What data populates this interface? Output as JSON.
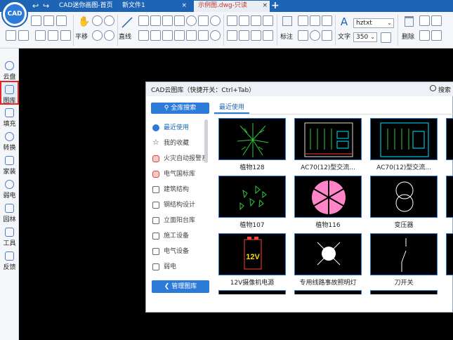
{
  "titlebar": {
    "tabs": [
      {
        "label": "CAD迷你画图-首页",
        "active": false
      },
      {
        "label": "新文件1",
        "active": false
      },
      {
        "label": "示例图.dwg-只读",
        "active": true
      }
    ],
    "tab_close": "×",
    "new_tab": "+",
    "logo_text": "CAD"
  },
  "toolbar": {
    "pan_label": "平移",
    "line_label": "直线",
    "annotate_label": "标注",
    "text_label": "文字",
    "delete_label": "删除",
    "font_value": "hztxt",
    "size_value": "350"
  },
  "sidebar": {
    "items": [
      {
        "label": "云盘",
        "active": false
      },
      {
        "label": "图库",
        "active": true
      },
      {
        "label": "填充",
        "active": false
      },
      {
        "label": "转换",
        "active": false
      },
      {
        "label": "家装",
        "active": false
      },
      {
        "label": "弱电",
        "active": false
      },
      {
        "label": "园林",
        "active": false
      },
      {
        "label": "工具",
        "active": false
      },
      {
        "label": "反馈",
        "active": false
      }
    ]
  },
  "dialog": {
    "title": "CAD云图库（快捷开关：Ctrl+Tab）",
    "search_label": "搜索",
    "all_search_button": "全库搜索",
    "recent_tab": "最近使用",
    "manage_button": "管理图库",
    "categories": [
      {
        "label": "最近使用",
        "icon": "clock-icon",
        "active": true
      },
      {
        "label": "我的收藏",
        "icon": "star-icon"
      },
      {
        "label": "火灾自动报警系",
        "icon": "shield-icon",
        "red": true
      },
      {
        "label": "电气国标库",
        "icon": "shield-icon",
        "red": true
      },
      {
        "label": "建筑结构",
        "icon": "image-icon"
      },
      {
        "label": "钢结构设计",
        "icon": "image-icon"
      },
      {
        "label": "立面阳台库",
        "icon": "image-icon"
      },
      {
        "label": "施工设备",
        "icon": "image-icon"
      },
      {
        "label": "电气设备",
        "icon": "image-icon"
      },
      {
        "label": "弱电",
        "icon": "image-icon"
      }
    ],
    "thumb_badge": "12V",
    "items": [
      {
        "label": "植物128"
      },
      {
        "label": "AC70(12)型交流..."
      },
      {
        "label": "AC70(12)型交流..."
      },
      {
        "label": "植物107"
      },
      {
        "label": "植物116"
      },
      {
        "label": "变压器"
      },
      {
        "label": "12V摄像机电源"
      },
      {
        "label": "专用线路事故照明灯"
      },
      {
        "label": "刀开关"
      }
    ]
  }
}
